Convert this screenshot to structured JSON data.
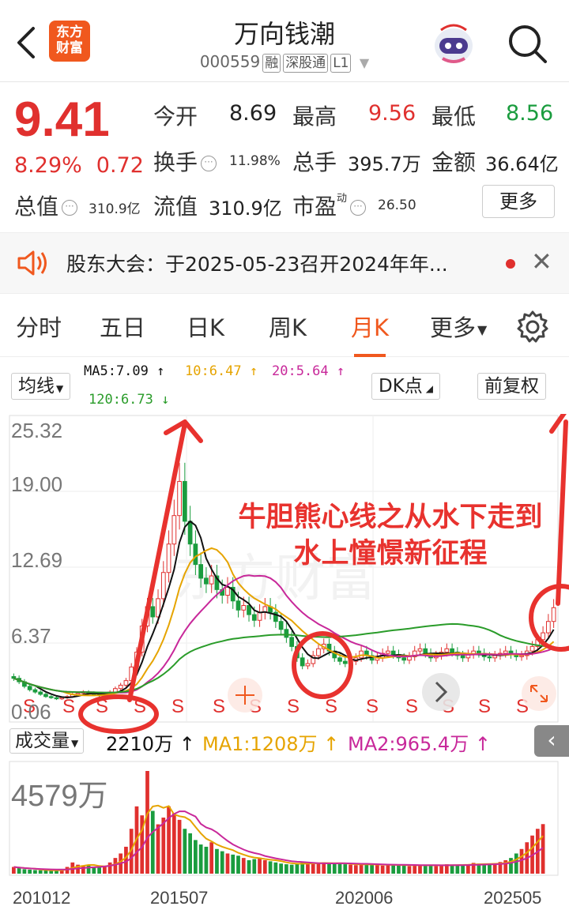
{
  "header": {
    "broker_logo": [
      "东方",
      "财富"
    ],
    "stock_name": "万向钱潮",
    "stock_code": "000559",
    "tags": [
      "融",
      "深股通",
      "L1"
    ]
  },
  "quote": {
    "price": "9.41",
    "change_pct": "8.29%",
    "change_amt": "0.72",
    "fields": {
      "open_label": "今开",
      "open": "8.69",
      "high_label": "最高",
      "high": "9.56",
      "low_label": "最低",
      "low": "8.56",
      "turnover_label": "换手",
      "turnover": "11.98%",
      "volume_label": "总手",
      "volume": "395.7万",
      "amount_label": "金额",
      "amount": "36.64亿",
      "mktcap_label": "总值",
      "mktcap": "310.9亿",
      "float_label": "流值",
      "float": "310.9亿",
      "pe_label": "市盈",
      "pe_sup": "动",
      "pe": "26.50"
    },
    "more_button": "更多"
  },
  "notice": {
    "text": "股东大会：于2025-05-23召开2024年年..."
  },
  "tabs": [
    {
      "label": "分时",
      "active": false
    },
    {
      "label": "五日",
      "active": false
    },
    {
      "label": "日K",
      "active": false
    },
    {
      "label": "周K",
      "active": false
    },
    {
      "label": "月K",
      "active": true
    },
    {
      "label": "更多",
      "active": false
    }
  ],
  "ma_bar": {
    "selector": "均线",
    "ma5": "MA5:7.09 ↑",
    "ma10": "10:6.47 ↑",
    "ma20": "20:5.64 ↑",
    "ma120": "120:6.73 ↓",
    "dk": "DK点",
    "adjust": "前复权"
  },
  "chart_data": {
    "type": "line",
    "y_ticks": [
      "25.32",
      "19.00",
      "12.69",
      "6.37",
      "0.06"
    ],
    "x_ticks": [
      "201012",
      "201507",
      "202006",
      "202505"
    ],
    "s_marker": "S",
    "annotation": [
      "牛胆熊心线之从水下走到",
      "水上憧憬新征程"
    ],
    "watermark": "东方财富",
    "colors": {
      "up": "#e0302e",
      "down": "#1a9c3e",
      "ma5": "#111111",
      "ma10": "#e6a400",
      "ma20": "#c8289a",
      "ma120": "#2a9c2a",
      "annot": "#e8322e"
    },
    "price_series": [
      3.2,
      2.9,
      2.5,
      2.2,
      2.0,
      1.8,
      1.6,
      1.5,
      1.4,
      1.5,
      1.6,
      1.8,
      1.9,
      2.0,
      1.9,
      1.8,
      1.7,
      1.8,
      2.0,
      2.3,
      2.6,
      3.0,
      4.2,
      5.5,
      7.8,
      9.5,
      8.6,
      10.2,
      12.5,
      15.0,
      17.5,
      20.5,
      17.0,
      15.0,
      13.2,
      12.0,
      11.5,
      12.2,
      11.0,
      10.5,
      11.2,
      10.0,
      9.2,
      9.6,
      8.8,
      8.3,
      9.0,
      9.5,
      9.0,
      8.2,
      7.5,
      6.8,
      6.0,
      5.0,
      4.3,
      4.5,
      5.2,
      5.8,
      6.2,
      5.6,
      5.0,
      4.7,
      4.5,
      4.7,
      5.0,
      5.6,
      5.2,
      4.8,
      5.0,
      5.4,
      5.6,
      5.3,
      5.0,
      4.8,
      5.1,
      5.6,
      5.8,
      5.4,
      5.0,
      5.2,
      5.5,
      5.8,
      5.5,
      5.2,
      5.0,
      5.3,
      5.6,
      5.4,
      5.1,
      5.0,
      5.2,
      5.4,
      5.6,
      5.3,
      5.1,
      5.2,
      5.6,
      6.0,
      6.6,
      7.2,
      8.2,
      9.41
    ],
    "volume_ticks": [
      "4579万"
    ],
    "volume_series": [
      300,
      250,
      200,
      180,
      160,
      150,
      140,
      130,
      160,
      200,
      300,
      500,
      400,
      350,
      380,
      300,
      280,
      320,
      500,
      700,
      900,
      1200,
      2000,
      3000,
      2600,
      4579,
      2800,
      2200,
      2500,
      3000,
      2700,
      2400,
      2000,
      1800,
      1500,
      1300,
      1200,
      1400,
      1100,
      1000,
      900,
      850,
      800,
      700,
      600,
      650,
      700,
      600,
      550,
      500,
      450,
      420,
      400,
      450,
      500,
      480,
      460,
      440,
      500,
      480,
      460,
      440,
      420,
      400,
      380,
      420,
      450,
      400,
      380,
      360,
      400,
      420,
      380,
      360,
      340,
      380,
      400,
      380,
      360,
      340,
      380,
      420,
      400,
      380,
      360,
      420,
      480,
      450,
      420,
      400,
      450,
      520,
      600,
      700,
      900,
      1100,
      1400,
      1700,
      2000,
      2210
    ],
    "volume_bar": {
      "selector": "成交量",
      "vol": "2210万 ↑",
      "ma1": "MA1:1208万 ↑",
      "ma2": "MA2:965.4万 ↑"
    }
  }
}
